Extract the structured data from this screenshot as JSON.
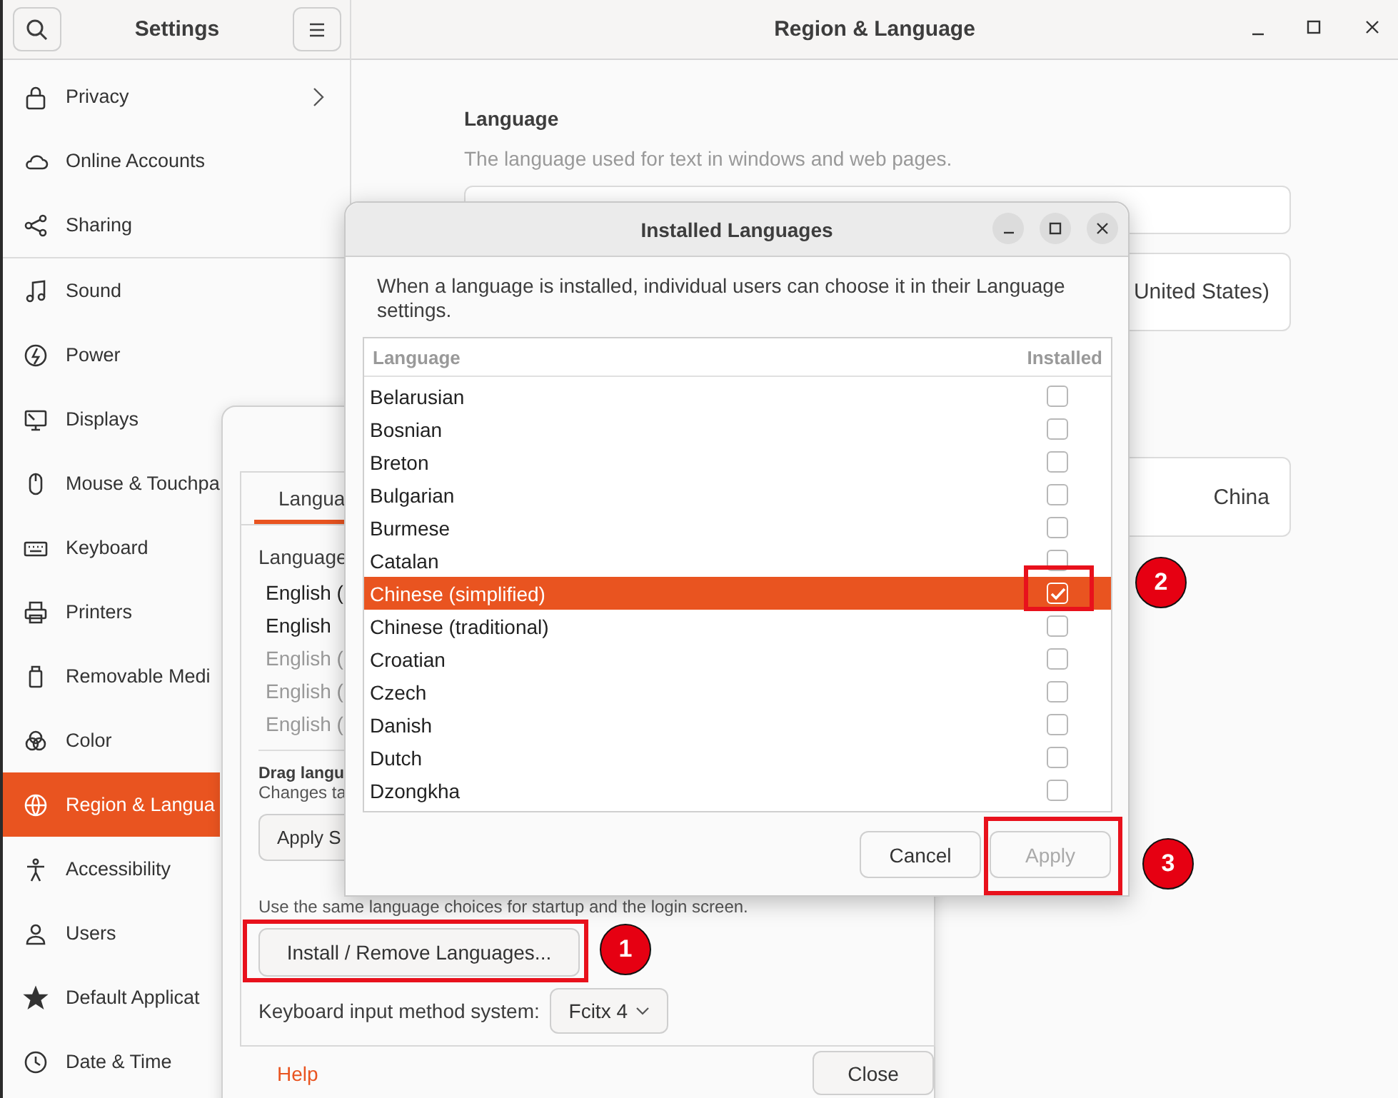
{
  "settings": {
    "title": "Settings",
    "sidebar": {
      "groups": [
        [
          {
            "label": "Privacy",
            "submenu": true,
            "selected": false
          },
          {
            "label": "Online Accounts",
            "submenu": false,
            "selected": false
          },
          {
            "label": "Sharing",
            "submenu": false,
            "selected": false
          }
        ],
        [
          {
            "label": "Sound",
            "submenu": false,
            "selected": false
          },
          {
            "label": "Power",
            "submenu": false,
            "selected": false
          },
          {
            "label": "Displays",
            "submenu": false,
            "selected": false
          },
          {
            "label": "Mouse & Touchpa",
            "submenu": false,
            "selected": false
          },
          {
            "label": "Keyboard",
            "submenu": false,
            "selected": false
          },
          {
            "label": "Printers",
            "submenu": false,
            "selected": false
          },
          {
            "label": "Removable Medi",
            "submenu": false,
            "selected": false
          },
          {
            "label": "Color",
            "submenu": false,
            "selected": false
          },
          {
            "label": "Region & Langua",
            "submenu": false,
            "selected": true
          },
          {
            "label": "Accessibility",
            "submenu": false,
            "selected": false
          },
          {
            "label": "Users",
            "submenu": false,
            "selected": false
          },
          {
            "label": "Default Applicat",
            "submenu": false,
            "selected": false
          },
          {
            "label": "Date & Time",
            "submenu": false,
            "selected": false
          }
        ]
      ]
    }
  },
  "panel": {
    "title": "Region & Language",
    "heading": "Language",
    "description": "The language used for text in windows and web pages.",
    "language_value": "United States)",
    "formats_value": "China"
  },
  "language_support": {
    "tab": "Langua",
    "list_label": "Language",
    "languages": [
      {
        "label": "English (",
        "dimmed": false
      },
      {
        "label": "English",
        "dimmed": false
      },
      {
        "label": "English (",
        "dimmed": true
      },
      {
        "label": "English (",
        "dimmed": true
      },
      {
        "label": "English (",
        "dimmed": true
      }
    ],
    "drag_hint": "Drag langu",
    "changes_hint": "Changes ta",
    "apply_button": "Apply S",
    "same_hint": "Use the same language choices for startup and the login screen.",
    "install_button": "Install / Remove Languages...",
    "input_method_label": "Keyboard input method system:",
    "input_method_value": "Fcitx 4",
    "help_link": "Help",
    "close_button": "Close"
  },
  "installed_dialog": {
    "title": "Installed Languages",
    "description": "When a language is installed, individual users can choose it in their Language settings.",
    "columns": [
      "Language",
      "Installed"
    ],
    "rows": [
      {
        "name": "Belarusian",
        "installed": false,
        "selected": false
      },
      {
        "name": "Bosnian",
        "installed": false,
        "selected": false
      },
      {
        "name": "Breton",
        "installed": false,
        "selected": false
      },
      {
        "name": "Bulgarian",
        "installed": false,
        "selected": false
      },
      {
        "name": "Burmese",
        "installed": false,
        "selected": false
      },
      {
        "name": "Catalan",
        "installed": false,
        "selected": false
      },
      {
        "name": "Chinese (simplified)",
        "installed": true,
        "selected": true
      },
      {
        "name": "Chinese (traditional)",
        "installed": false,
        "selected": false
      },
      {
        "name": "Croatian",
        "installed": false,
        "selected": false
      },
      {
        "name": "Czech",
        "installed": false,
        "selected": false
      },
      {
        "name": "Danish",
        "installed": false,
        "selected": false
      },
      {
        "name": "Dutch",
        "installed": false,
        "selected": false
      },
      {
        "name": "Dzongkha",
        "installed": false,
        "selected": false
      }
    ],
    "buttons": [
      {
        "label": "Cancel",
        "disabled": false
      },
      {
        "label": "Apply",
        "disabled": true
      }
    ]
  },
  "annotations": [
    {
      "number": "1"
    },
    {
      "number": "2"
    },
    {
      "number": "3"
    }
  ]
}
